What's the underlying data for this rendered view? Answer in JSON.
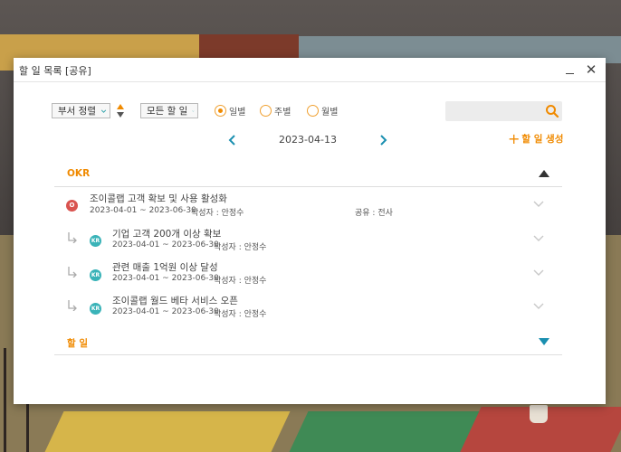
{
  "window": {
    "title": "할 일 목록 [공유]",
    "minimize_icon": "minimize-icon",
    "close_icon": "close-icon",
    "close_glyph": "✕"
  },
  "toolbar": {
    "dept_sort_label": "부서 정렬",
    "filter_label": "모든 할 일",
    "sort_icon": "sort-arrows-icon",
    "period_options": [
      {
        "label": "일별",
        "selected": true
      },
      {
        "label": "주별",
        "selected": false
      },
      {
        "label": "월별",
        "selected": false
      }
    ],
    "search": {
      "placeholder": "",
      "value": "",
      "icon": "search-icon"
    }
  },
  "date_nav": {
    "date": "2023-04-13",
    "prev_icon": "chevron-left-icon",
    "next_icon": "chevron-right-icon"
  },
  "create_button": {
    "label": "할 일 생성",
    "icon": "plus-icon"
  },
  "okr_section": {
    "title": "OKR",
    "items": [
      {
        "badge": "O",
        "name": "조이콜랩 고객 확보 및 사용 활성화",
        "period": "2023-04-01 ~ 2023-06-30",
        "author": "작성자 : 안정수",
        "share": "공유 : 전사"
      },
      {
        "badge": "KR",
        "name": "기업 고객 200개 이상 확보",
        "period": "2023-04-01 ~ 2023-06-30",
        "author": "작성자 : 안정수"
      },
      {
        "badge": "KR",
        "name": "관련 매출 1억원 이상 달성",
        "period": "2023-04-01 ~ 2023-06-30",
        "author": "작성자 : 안정수"
      },
      {
        "badge": "KR",
        "name": "조이콜랩 월드 베타 서비스 오픈",
        "period": "2023-04-01 ~ 2023-06-30",
        "author": "작성자 : 안정수"
      }
    ]
  },
  "todo_section": {
    "title": "할 일"
  },
  "colors": {
    "accent": "#f08a00",
    "nav_arrow": "#1a8fb0",
    "todo_triangle": "#1a8fb0",
    "objective_badge": "#d9534f",
    "kr_badge": "#3ab3b8"
  }
}
